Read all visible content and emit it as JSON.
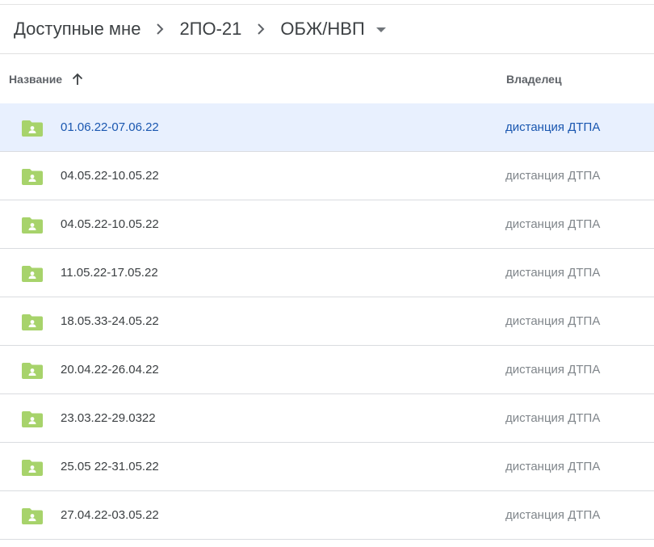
{
  "breadcrumb": {
    "items": [
      "Доступные мне",
      "2ПО-21",
      "ОБЖ/НВП"
    ]
  },
  "columns": {
    "name": "Название",
    "owner": "Владелец"
  },
  "colors": {
    "folder": "#a7d36b",
    "selected_bg": "#e8f0fe",
    "selected_text": "#1a57b0"
  },
  "files": [
    {
      "name": "01.06.22-07.06.22",
      "owner": "дистанция ДТПА",
      "selected": true
    },
    {
      "name": "04.05.22-10.05.22",
      "owner": "дистанция ДТПА"
    },
    {
      "name": "04.05.22-10.05.22",
      "owner": "дистанция ДТПА"
    },
    {
      "name": "11.05.22-17.05.22",
      "owner": "дистанция ДТПА"
    },
    {
      "name": "18.05.33-24.05.22",
      "owner": "дистанция ДТПА"
    },
    {
      "name": "20.04.22-26.04.22",
      "owner": "дистанция ДТПА"
    },
    {
      "name": "23.03.22-29.0322",
      "owner": "дистанция ДТПА"
    },
    {
      "name": "25.05 22-31.05.22",
      "owner": "дистанция ДТПА"
    },
    {
      "name": "27.04.22-03.05.22",
      "owner": "дистанция ДТПА"
    }
  ]
}
